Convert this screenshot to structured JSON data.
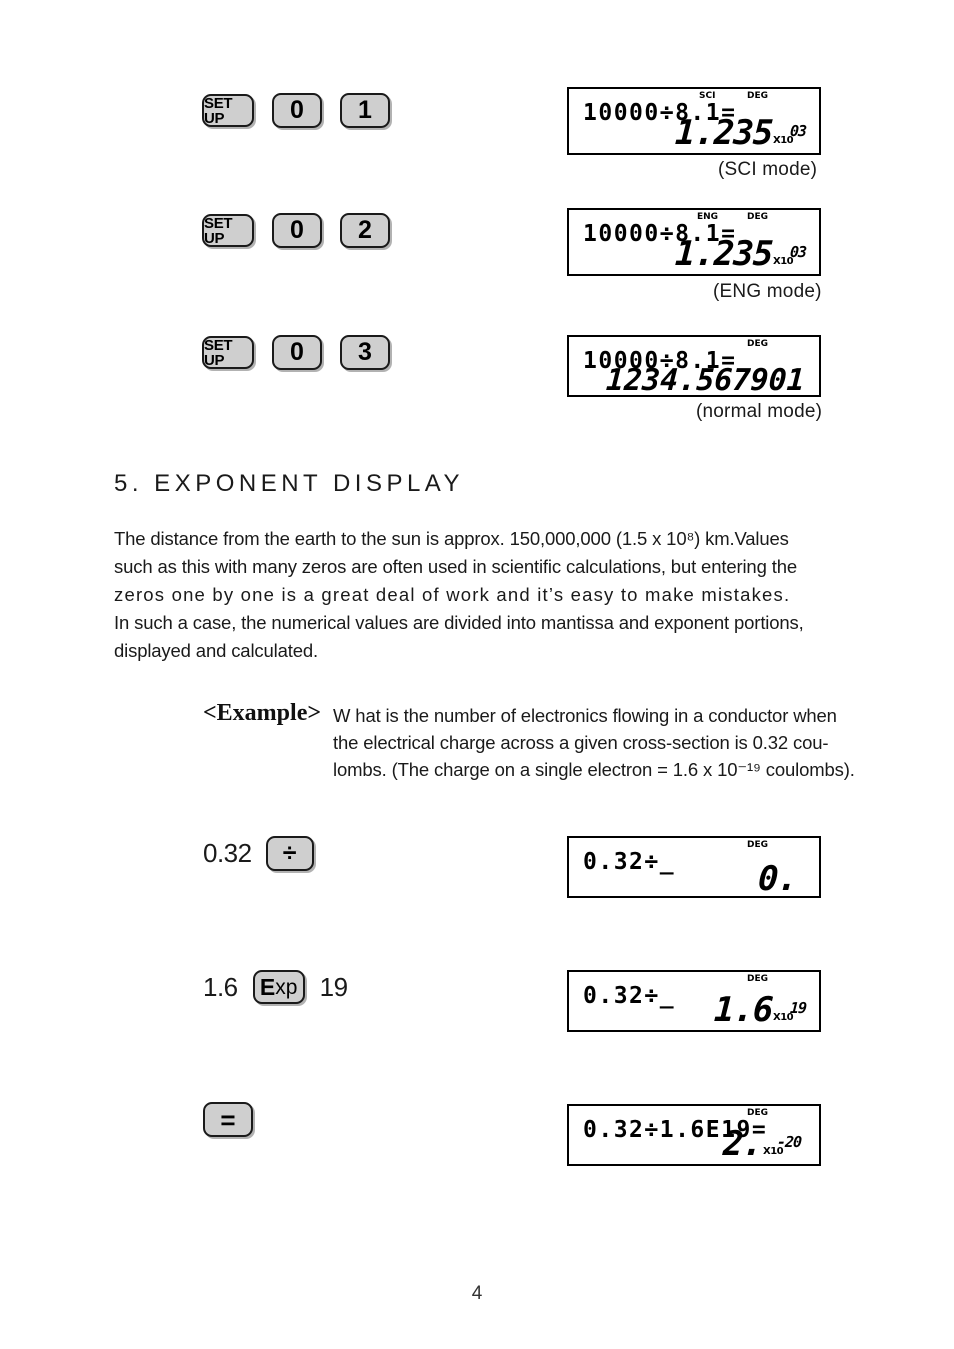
{
  "page": {
    "number": "4"
  },
  "mode_rows": [
    {
      "keys": [
        "SET UP",
        "0",
        "1"
      ],
      "display": {
        "flags": [
          "SCI",
          "DEG"
        ],
        "entry": "10000÷8.1=",
        "mantissa": "1.235",
        "x10_label": "X10",
        "exponent": "03"
      },
      "caption": "(SCI mode)"
    },
    {
      "keys": [
        "SET UP",
        "0",
        "2"
      ],
      "display": {
        "flags": [
          "ENG",
          "DEG"
        ],
        "entry": "10000÷8.1=",
        "mantissa": "1.235",
        "x10_label": "X10",
        "exponent": "03"
      },
      "caption": "(ENG mode)"
    },
    {
      "keys": [
        "SET UP",
        "0",
        "3"
      ],
      "display": {
        "flags": [
          "DEG"
        ],
        "entry": "10000÷8.1=",
        "mantissa": "1234.567901",
        "x10_label": "",
        "exponent": ""
      },
      "caption": "(normal mode)"
    }
  ],
  "section": {
    "heading": "5. EXPONENT DISPLAY",
    "paragraph_lines": [
      "The distance from the earth to the sun is approx. 150,000,000 (1.5 x 10⁸) km.Values",
      "such as this with many zeros are often used in scientific calculations, but entering the",
      "zeros one by one is a great deal of work and it’s easy to make mistakes.",
      "In such a case, the numerical values are divided into mantissa and exponent portions,",
      "displayed and calculated."
    ]
  },
  "example": {
    "label": "<Example>",
    "lines": [
      "W hat is the number of electronics flowing in a conductor when",
      "the electrical charge across a given cross-section is 0.32 cou-",
      "lombs. (The charge on a single electron = 1.6 x 10⁻¹⁹ coulombs)."
    ]
  },
  "steps": [
    {
      "prefix": "0.32",
      "key": "÷",
      "suffix": "",
      "display": {
        "flags": [
          "DEG"
        ],
        "entry": "0.32÷_",
        "mantissa": "0.",
        "x10_label": "",
        "exponent": ""
      }
    },
    {
      "prefix": "1.6",
      "key": "Exp",
      "suffix": "19",
      "display": {
        "flags": [
          "DEG"
        ],
        "entry": "0.32÷_",
        "mantissa": "1.6",
        "x10_label": "X10",
        "exponent": "19"
      }
    },
    {
      "prefix": "",
      "key": "=",
      "suffix": "",
      "display": {
        "flags": [
          "DEG"
        ],
        "entry": "0.32÷1.6E19=",
        "mantissa": "2.",
        "x10_label": "X10",
        "exponent": "-20"
      }
    }
  ],
  "colors": {
    "key_face": "#cfcfcf",
    "ink": "#1a1a1a",
    "lcd_border": "#000000"
  }
}
